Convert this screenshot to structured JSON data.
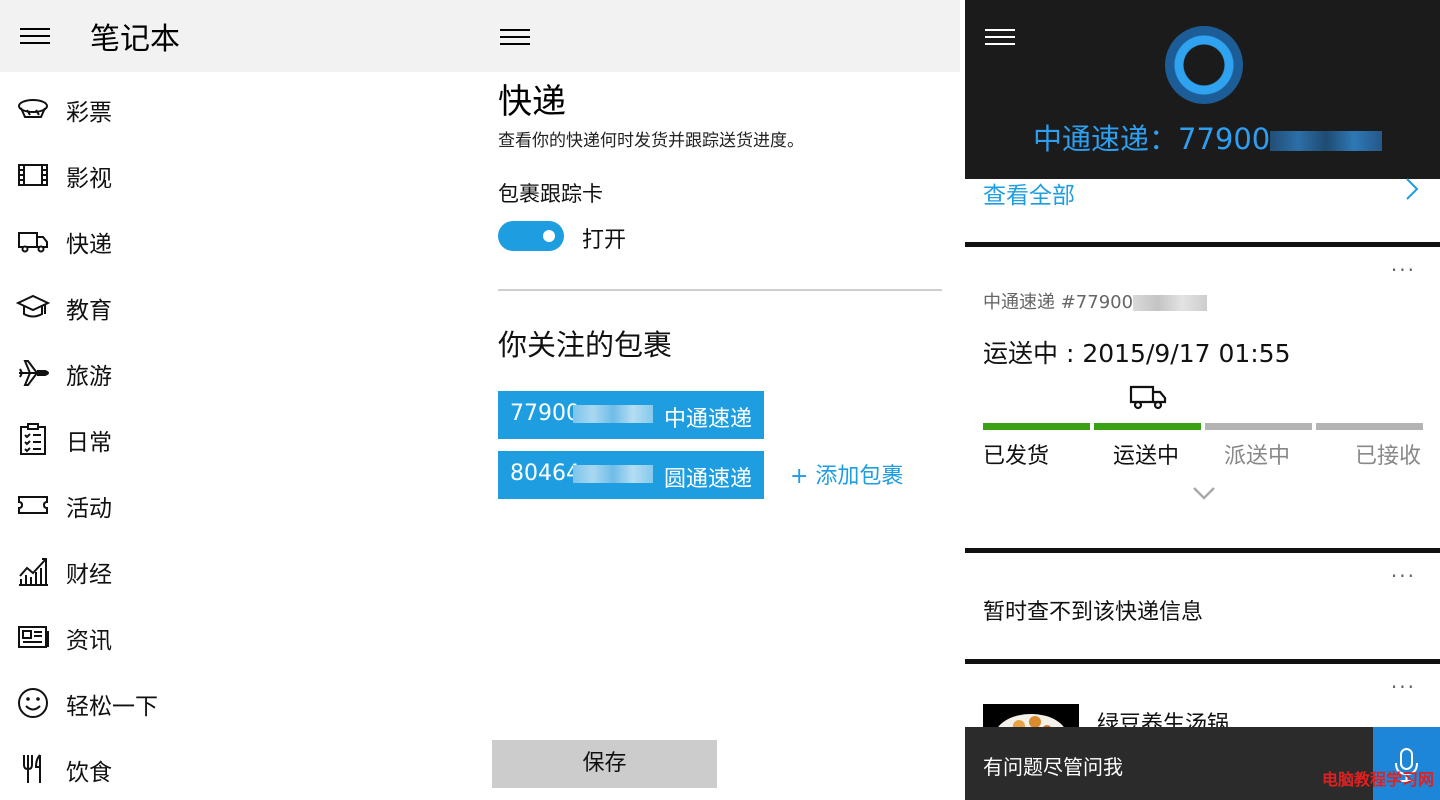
{
  "notebook": {
    "title": "笔记本",
    "items": [
      {
        "label": "彩票",
        "icon": "lottery-icon"
      },
      {
        "label": "影视",
        "icon": "film-icon"
      },
      {
        "label": "快递",
        "icon": "truck-icon"
      },
      {
        "label": "教育",
        "icon": "education-icon"
      },
      {
        "label": "旅游",
        "icon": "airplane-icon"
      },
      {
        "label": "日常",
        "icon": "clipboard-icon"
      },
      {
        "label": "活动",
        "icon": "ticket-icon"
      },
      {
        "label": "财经",
        "icon": "chart-icon"
      },
      {
        "label": "资讯",
        "icon": "news-icon"
      },
      {
        "label": "轻松一下",
        "icon": "smiley-icon"
      },
      {
        "label": "饮食",
        "icon": "fork-icon"
      }
    ]
  },
  "courier": {
    "title": "快递",
    "description": "查看你的快递何时发货并跟踪送货进度。",
    "card_label": "包裹跟踪卡",
    "toggle_state": "打开",
    "toggle_on": true,
    "section_title": "你关注的包裹",
    "packages": [
      {
        "number": "77900",
        "carrier": "中通速递"
      },
      {
        "number": "80464",
        "carrier": "圆通速递"
      }
    ],
    "add_label": "+ 添加包裹",
    "save_label": "保存"
  },
  "cortana": {
    "query_prefix": "中通速递：77900",
    "see_all": "查看全部",
    "more_glyph": "···",
    "tracking": {
      "id_prefix": "中通速递 #77900",
      "status": "运送中 : 2015/9/17 01:55",
      "steps": [
        {
          "label": "已发货",
          "done": true
        },
        {
          "label": "运送中",
          "done": true
        },
        {
          "label": "派送中",
          "done": false
        },
        {
          "label": "已接收",
          "done": false
        }
      ]
    },
    "no_info": "暂时查不到该快递信息",
    "food_title": "绿豆养生汤锅",
    "ask_placeholder": "有问题尽管问我",
    "watermark": "电脑教程学习网"
  },
  "colors": {
    "accent": "#1e9ee0",
    "step_done": "#3aa014",
    "step_pending": "#b3b3b3",
    "header_light": "#f2f2f2",
    "header_dark": "#1b1b1b"
  }
}
